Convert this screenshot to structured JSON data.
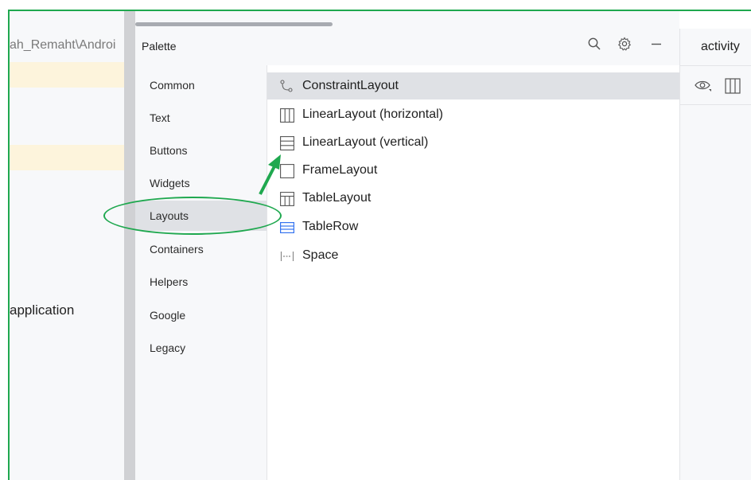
{
  "editor": {
    "path_text": "ah_Remaht\\Androi",
    "code_fragment": "application"
  },
  "palette": {
    "title": "Palette",
    "categories": [
      {
        "label": "Common"
      },
      {
        "label": "Text"
      },
      {
        "label": "Buttons"
      },
      {
        "label": "Widgets"
      },
      {
        "label": "Layouts"
      },
      {
        "label": "Containers"
      },
      {
        "label": "Helpers"
      },
      {
        "label": "Google"
      },
      {
        "label": "Legacy"
      }
    ],
    "selected_category": "Layouts",
    "items": [
      {
        "label": "ConstraintLayout",
        "icon": "constraint-layout-icon"
      },
      {
        "label": "LinearLayout (horizontal)",
        "icon": "linear-horizontal-icon"
      },
      {
        "label": "LinearLayout (vertical)",
        "icon": "linear-vertical-icon"
      },
      {
        "label": "FrameLayout",
        "icon": "frame-layout-icon"
      },
      {
        "label": "TableLayout",
        "icon": "table-layout-icon"
      },
      {
        "label": "TableRow",
        "icon": "table-row-icon"
      },
      {
        "label": "Space",
        "icon": "space-icon"
      }
    ],
    "selected_item": "ConstraintLayout"
  },
  "right_panel": {
    "tab_title": "activity"
  },
  "colors": {
    "annotation": "#1fa84f",
    "selection": "#dfe1e5",
    "highlight_line": "#fdf4dc",
    "table_row_icon": "#3574f0"
  }
}
